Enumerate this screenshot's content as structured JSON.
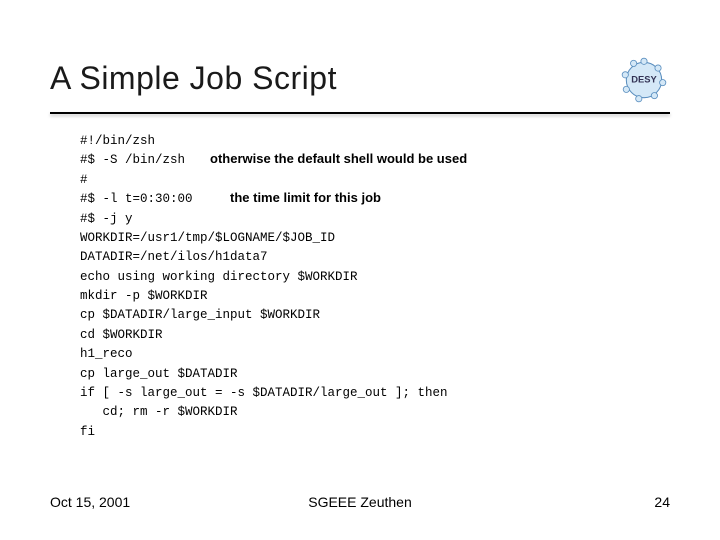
{
  "title": "A Simple Job Script",
  "logo_text": "DESY",
  "code": {
    "l0": "#!/bin/zsh",
    "l1": "#$ -S /bin/zsh",
    "l2": "#",
    "l3": "#$ -l t=0:30:00",
    "l4": "#$ -j y",
    "l5": "WORKDIR=/usr1/tmp/$LOGNAME/$JOB_ID",
    "l6": "DATADIR=/net/ilos/h1data7",
    "l7": "echo using working directory $WORKDIR",
    "l8": "mkdir -p $WORKDIR",
    "l9": "cp $DATADIR/large_input $WORKDIR",
    "l10": "cd $WORKDIR",
    "l11": "h1_reco",
    "l12": "cp large_out $DATADIR",
    "l13": "if [ -s large_out = -s $DATADIR/large_out ]; then",
    "l14": "   cd; rm -r $WORKDIR",
    "l15": "fi"
  },
  "annotations": {
    "shell": "otherwise the default shell would be used",
    "timelimit": "the time limit for this job"
  },
  "footer": {
    "date": "Oct 15, 2001",
    "center": "SGEEE Zeuthen",
    "page": "24"
  }
}
